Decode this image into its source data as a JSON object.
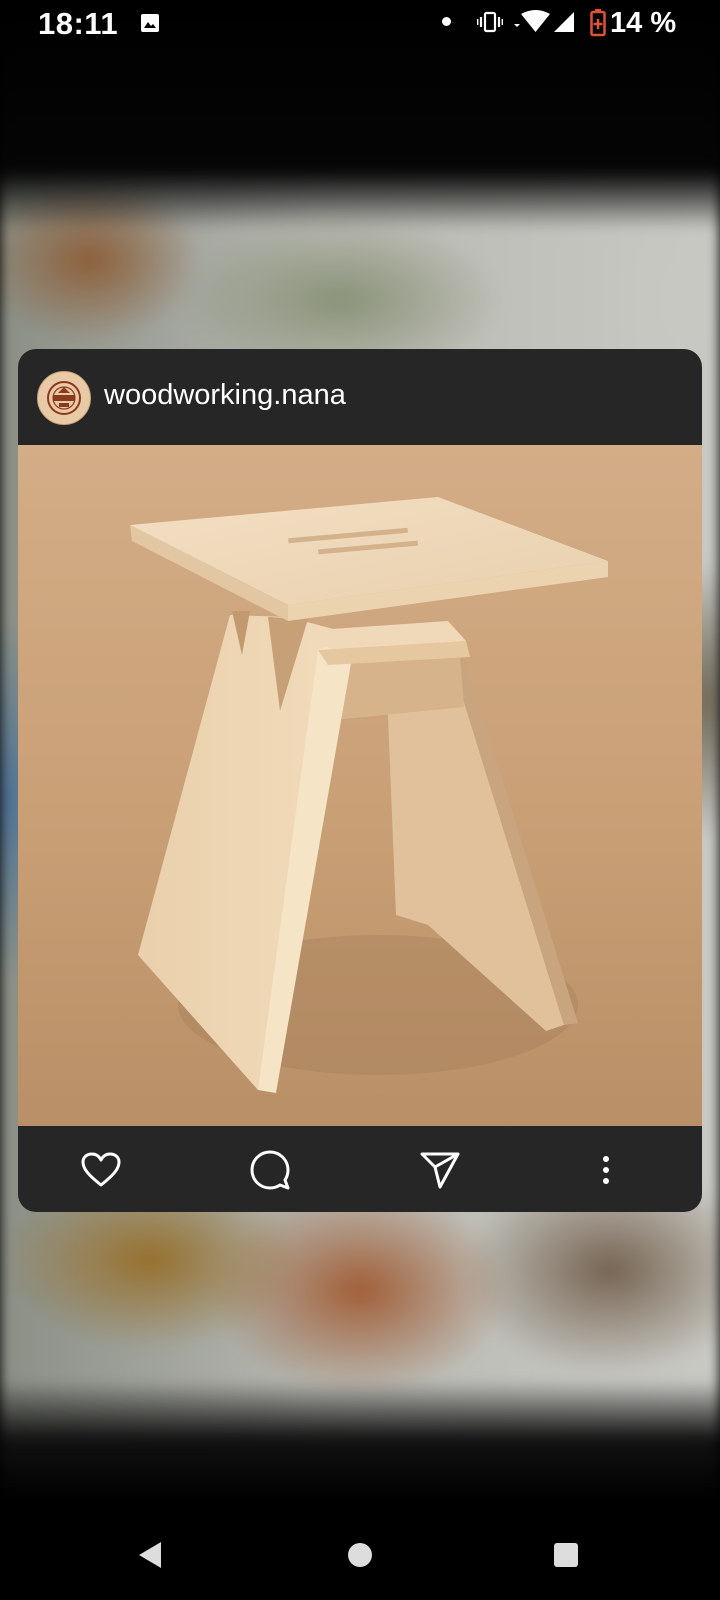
{
  "status_bar": {
    "time": "18:11",
    "battery_percent": "14 %",
    "icons": [
      "gallery-icon",
      "notification-dot",
      "vibrate-icon",
      "wifi-icon",
      "signal-icon",
      "battery-charging-icon"
    ]
  },
  "post": {
    "username": "woodworking.nana",
    "avatar_icon": "woodworking-logo",
    "photo_subject": "wooden-stool",
    "actions": [
      "heart-icon",
      "comment-icon",
      "share-icon",
      "more-icon"
    ]
  },
  "navigation": [
    "back-icon",
    "home-icon",
    "recents-icon"
  ],
  "colors": {
    "card_background": "#262626",
    "text": "#ffffff",
    "battery_accent": "#e0523a"
  }
}
